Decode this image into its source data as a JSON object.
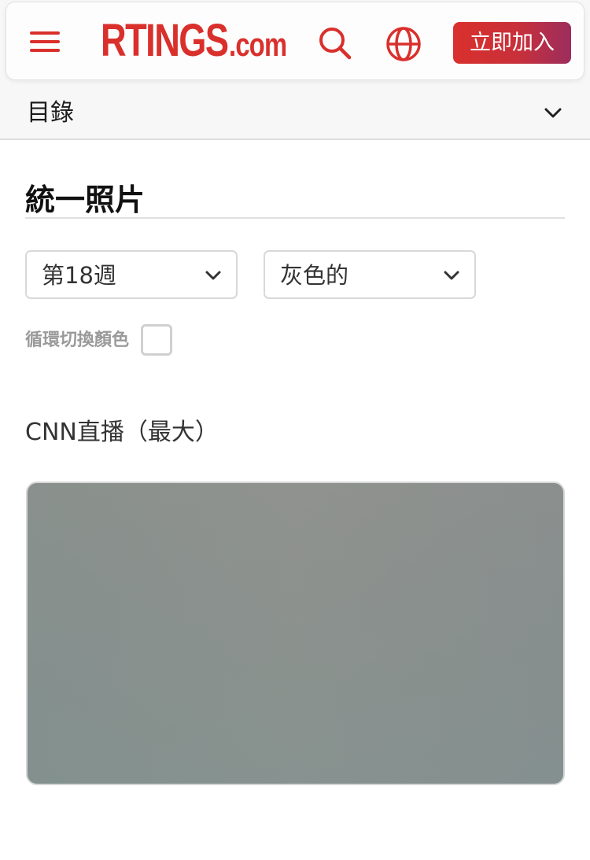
{
  "header": {
    "logo_main": "RTINGS",
    "logo_suffix": ".com",
    "join_label": "立即加入",
    "menu_icon": "hamburger-menu-icon",
    "search_icon": "search-icon",
    "language_icon": "globe-icon"
  },
  "toc": {
    "label": "目錄",
    "icon": "chevron-down-icon"
  },
  "section": {
    "title": "統一照片"
  },
  "filters": {
    "week_value": "第18週",
    "color_value": "灰色的",
    "cycle_label": "循環切換顏色",
    "cycle_checked": false
  },
  "photo": {
    "caption": "CNN直播（最大）"
  },
  "colors": {
    "brand_red": "#d9302c",
    "join_gradient_end": "#9c2d5e",
    "photo_gray": "#8c918e"
  }
}
